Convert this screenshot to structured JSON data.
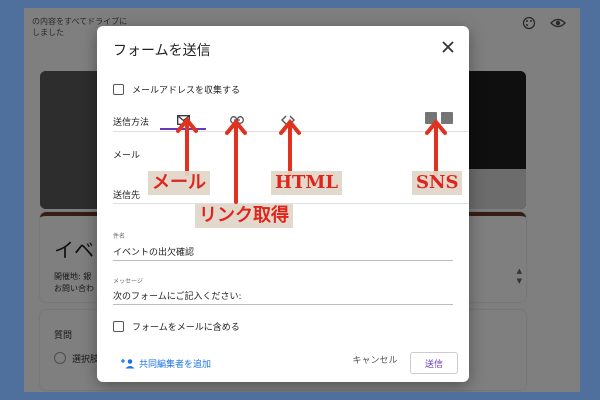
{
  "background": {
    "top_text_line1": "の内容をすべてドライブに",
    "top_text_line2": "しました",
    "form_title": "イベ",
    "sub_line1": "開催地: 銀",
    "sub_line2": "お問い合わ",
    "question_label": "質問",
    "option_label": "選択肢"
  },
  "dialog": {
    "title": "フォームを送信",
    "collect_email_label": "メールアドレスを収集する",
    "send_method_label": "送信方法",
    "email_section_label": "メール",
    "to_label": "送信先",
    "subject_small_label": "件名",
    "subject_value": "イベントの出欠確認",
    "message_small_label": "メッセージ",
    "message_value": "次のフォームにご記入ください:",
    "include_form_label": "フォームをメールに含める",
    "add_collaborators_label": "共同編集者を追加",
    "cancel_label": "キャンセル",
    "send_label": "送信"
  },
  "annotations": {
    "mail": "メール",
    "link": "リンク取得",
    "html": "HTML",
    "sns": "SNS"
  },
  "icons": {
    "email_tab": "mail-icon",
    "link_tab": "link-icon",
    "html_tab": "code-icon",
    "facebook": "facebook-icon",
    "twitter": "twitter-icon",
    "close": "close-icon",
    "add_person": "person-add-icon"
  },
  "colors": {
    "frame": "#4f6f9d",
    "accent": "#673ab7",
    "annotation_text": "#e0241b",
    "link_blue": "#1a73e8"
  }
}
